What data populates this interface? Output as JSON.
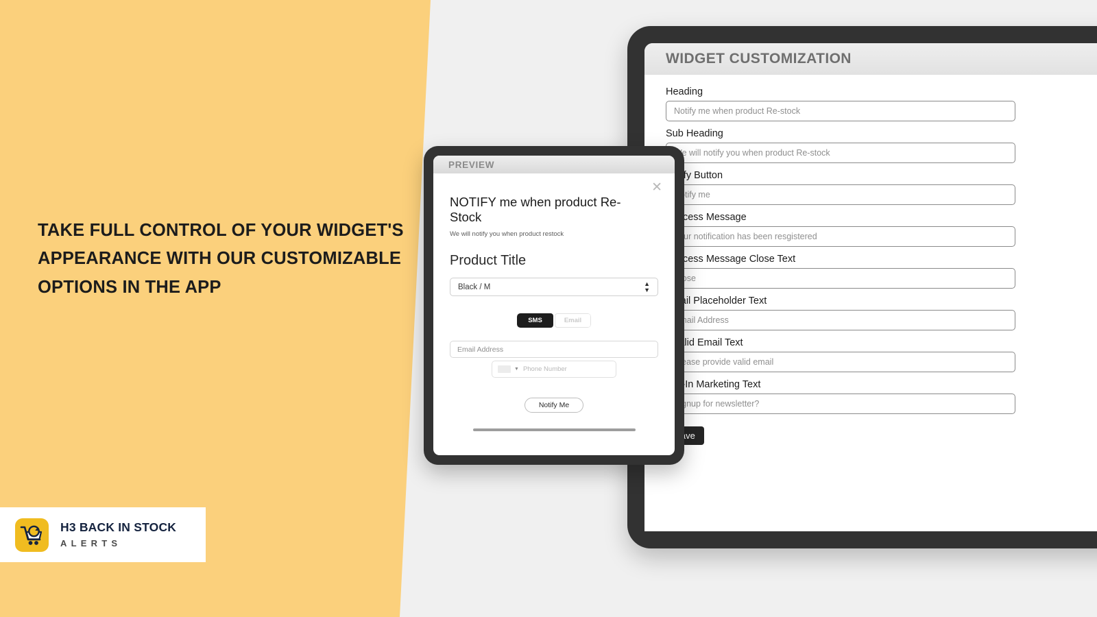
{
  "marketing": {
    "headline": "Take full control of your widget's appearance with our customizable options in the app",
    "background_color": "#fbd07c"
  },
  "logo": {
    "icon": "shopping-cart-refresh-icon",
    "brand_color": "#f0bc20",
    "title": "H3 BACK IN STOCK",
    "subtitle": "ALERTS"
  },
  "preview": {
    "header_title": "PREVIEW",
    "close_icon": "✕",
    "heading": "NOTIFY me when product Re-Stock",
    "sub_heading": "We will notify you when product restock",
    "product_title": "Product Title",
    "variant_selected": "Black / M",
    "variant_arrows": "↕",
    "toggle": {
      "sms_label": "SMS",
      "email_label": "Email",
      "active": "SMS"
    },
    "email_placeholder": "Email Address",
    "phone_placeholder": "Phone Number",
    "phone_caret": "▼",
    "notify_button": "Notify Me"
  },
  "customization": {
    "panel_title": "WIDGET CUSTOMIZATION",
    "fields": [
      {
        "label": "Heading",
        "value": "Notify me when product Re-stock"
      },
      {
        "label": "Sub Heading",
        "value": "We will notify you when product Re-stock"
      },
      {
        "label": "Notify Button",
        "value": "Notify me"
      },
      {
        "label": "Success Message",
        "value": "Your notification has been resgistered"
      },
      {
        "label": "Success Message Close Text",
        "value": "Close"
      },
      {
        "label": "Email Placeholder Text",
        "value": "Email Address"
      },
      {
        "label": "Invalid Email Text",
        "value": "Please provide valid email"
      },
      {
        "label": "Opt-In Marketing Text",
        "value": "Signup for newsletter?"
      }
    ],
    "save_label": "Save"
  }
}
